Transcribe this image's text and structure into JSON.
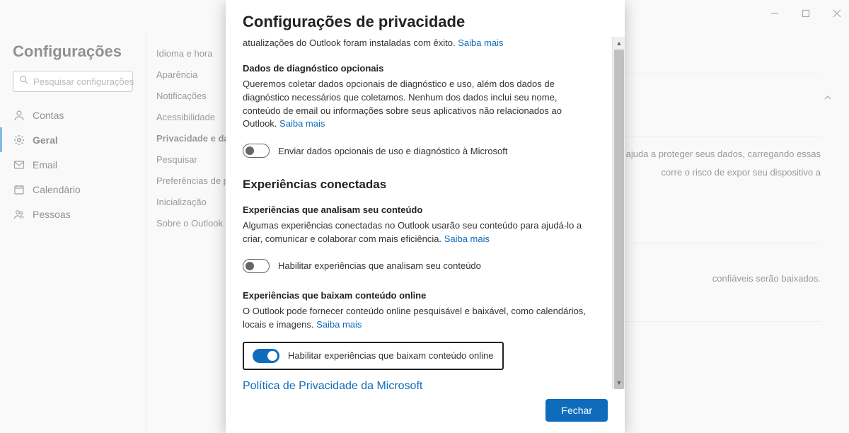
{
  "titlebar": {
    "minimize": "minimize",
    "maximize": "maximize",
    "close": "close"
  },
  "settings": {
    "title": "Configurações",
    "search_placeholder": "Pesquisar configurações"
  },
  "left_nav": [
    {
      "icon": "person",
      "label": "Contas"
    },
    {
      "icon": "gear",
      "label": "Geral",
      "active": true
    },
    {
      "icon": "mail",
      "label": "Email"
    },
    {
      "icon": "calendar",
      "label": "Calendário"
    },
    {
      "icon": "people",
      "label": "Pessoas"
    }
  ],
  "sub_nav": [
    "Idioma e hora",
    "Aparência",
    "Notificações",
    "Acessibilidade",
    "Privacidade e dados",
    "Pesquisar",
    "Preferências de publicidade",
    "Inicialização",
    "Sobre o Outlook"
  ],
  "sub_nav_selected": 4,
  "bg": {
    "para1_tail": "ajuda a proteger seus dados, carregando essas",
    "para2_tail": "corre o risco de expor seu dispositivo a",
    "para3_tail": "confiáveis serão baixados."
  },
  "modal": {
    "title": "Configurações de privacidade",
    "intro_tail": "atualizações do Outlook foram instaladas com êxito.",
    "saiba_mais": "Saiba mais",
    "dados_heading": "Dados de diagnóstico opcionais",
    "dados_text": "Queremos coletar dados opcionais de diagnóstico e uso, além dos dados de diagnóstico necessários que coletamos. Nenhum dos dados inclui seu nome, conteúdo de email ou informações sobre seus aplicativos não relacionados ao Outlook.",
    "toggle1_label": "Enviar dados opcionais de uso e diagnóstico à Microsoft",
    "conectadas_heading": "Experiências conectadas",
    "analisam_heading": "Experiências que analisam seu conteúdo",
    "analisam_text": "Algumas experiências conectadas no Outlook usarão seu conteúdo para ajudá-lo a criar, comunicar e colaborar com mais eficiência.",
    "toggle2_label": "Habilitar experiências que analisam seu conteúdo",
    "baixam_heading": "Experiências que baixam conteúdo online",
    "baixam_text": "O Outlook pode fornecer conteúdo online pesquisável e baixável, como calendários, locais e imagens.",
    "toggle3_label": "Habilitar experiências que baixam conteúdo online",
    "policy_link": "Política de Privacidade da Microsoft",
    "close_button": "Fechar"
  }
}
